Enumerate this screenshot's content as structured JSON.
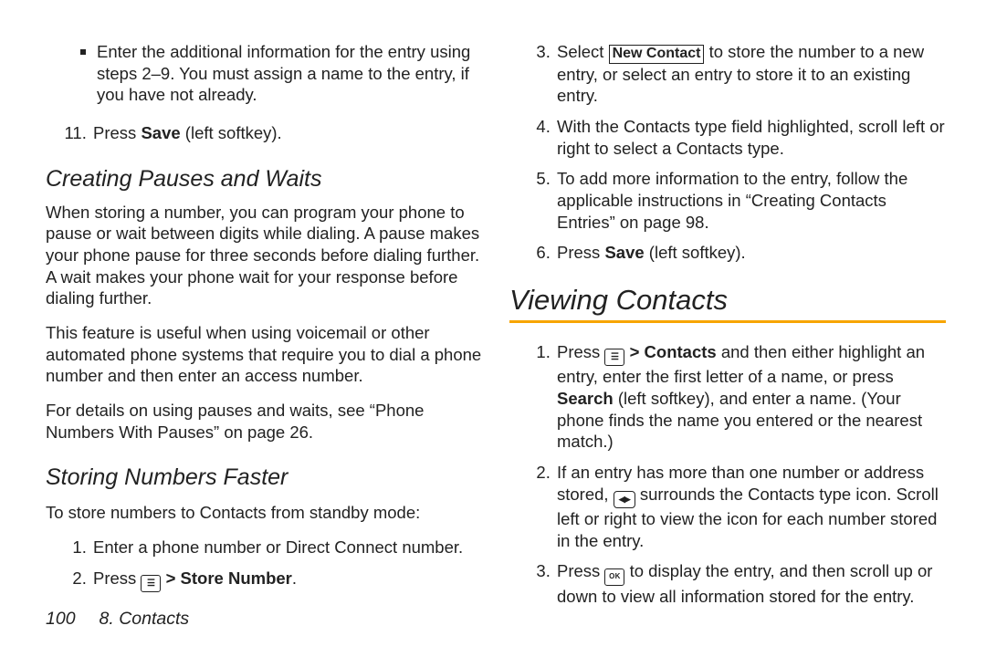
{
  "left": {
    "sub_bullet": "Enter the additional information for the entry using steps 2–9. You must assign a name to the entry, if you have not already.",
    "step11_a": "Press ",
    "step11_b": "Save",
    "step11_c": " (left softkey).",
    "h_pauses": "Creating Pauses and Waits",
    "p_pauses_1": "When storing a number, you can program your phone to pause or wait between digits while dialing. A pause makes your phone pause for three seconds before dialing further. A wait makes your phone wait for your response before dialing further.",
    "p_pauses_2": "This feature is useful when using voicemail or other automated phone systems that require you to dial a phone number and then enter an access number.",
    "p_pauses_3": "For details on using pauses and waits, see “Phone Numbers With Pauses” on page 26.",
    "h_storing": "Storing Numbers Faster",
    "p_storing_lead": "To store numbers to Contacts from standby mode:",
    "st1": "Enter a phone number or Direct Connect number.",
    "st2_a": "Press ",
    "st2_b": " > ",
    "st2_c": "Store Number",
    "st2_d": "."
  },
  "right": {
    "r3_a": "Select ",
    "r3_b": "New Contact",
    "r3_c": " to store the number to a new entry, or select an entry to store it to an existing entry.",
    "r4": "With the Contacts type field highlighted, scroll left or right to select a Contacts type.",
    "r5": "To add more information to the entry, follow the applicable instructions in “Creating Contacts Entries” on page 98.",
    "r6_a": "Press ",
    "r6_b": "Save",
    "r6_c": " (left softkey).",
    "h_viewing": "Viewing Contacts",
    "v1_a": "Press ",
    "v1_b": " > ",
    "v1_c": "Contacts",
    "v1_d": " and then either highlight an entry, enter the first letter of a name, or press ",
    "v1_e": "Search",
    "v1_f": " (left softkey), and enter a name. (Your phone finds the name you entered or the nearest match.)",
    "v2_a": "If an entry has more than one number or address stored, ",
    "v2_b": " surrounds the Contacts type icon. Scroll left or right to view the icon for each number stored in the entry.",
    "v3_a": "Press ",
    "v3_b": " to display the entry, and then scroll up or down to view all information stored for the entry."
  },
  "footer": {
    "page": "100",
    "chapter": "8. Contacts"
  }
}
